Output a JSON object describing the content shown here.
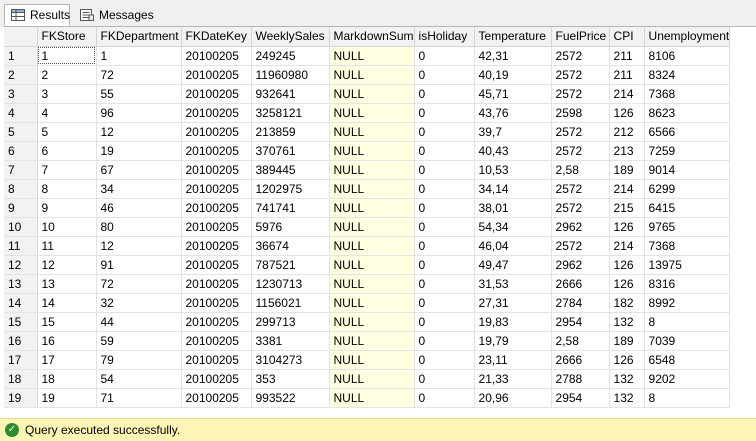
{
  "tabs": {
    "results_label": "Results",
    "messages_label": "Messages"
  },
  "grid": {
    "columns": [
      "",
      "FKStore",
      "FKDepartment",
      "FKDateKey",
      "WeeklySales",
      "MarkdownSum",
      "isHoliday",
      "Temperature",
      "FuelPrice",
      "CPI",
      "Unemployment"
    ],
    "rows": [
      [
        "1",
        "1",
        "1",
        "20100205",
        "249245",
        "NULL",
        "0",
        "42,31",
        "2572",
        "211",
        "8106"
      ],
      [
        "2",
        "2",
        "72",
        "20100205",
        "11960980",
        "NULL",
        "0",
        "40,19",
        "2572",
        "211",
        "8324"
      ],
      [
        "3",
        "3",
        "55",
        "20100205",
        "932641",
        "NULL",
        "0",
        "45,71",
        "2572",
        "214",
        "7368"
      ],
      [
        "4",
        "4",
        "96",
        "20100205",
        "3258121",
        "NULL",
        "0",
        "43,76",
        "2598",
        "126",
        "8623"
      ],
      [
        "5",
        "5",
        "12",
        "20100205",
        "213859",
        "NULL",
        "0",
        "39,7",
        "2572",
        "212",
        "6566"
      ],
      [
        "6",
        "6",
        "19",
        "20100205",
        "370761",
        "NULL",
        "0",
        "40,43",
        "2572",
        "213",
        "7259"
      ],
      [
        "7",
        "7",
        "67",
        "20100205",
        "389445",
        "NULL",
        "0",
        "10,53",
        "2,58",
        "189",
        "9014"
      ],
      [
        "8",
        "8",
        "34",
        "20100205",
        "1202975",
        "NULL",
        "0",
        "34,14",
        "2572",
        "214",
        "6299"
      ],
      [
        "9",
        "9",
        "46",
        "20100205",
        "741741",
        "NULL",
        "0",
        "38,01",
        "2572",
        "215",
        "6415"
      ],
      [
        "10",
        "10",
        "80",
        "20100205",
        "5976",
        "NULL",
        "0",
        "54,34",
        "2962",
        "126",
        "9765"
      ],
      [
        "11",
        "11",
        "12",
        "20100205",
        "36674",
        "NULL",
        "0",
        "46,04",
        "2572",
        "214",
        "7368"
      ],
      [
        "12",
        "12",
        "91",
        "20100205",
        "787521",
        "NULL",
        "0",
        "49,47",
        "2962",
        "126",
        "13975"
      ],
      [
        "13",
        "13",
        "72",
        "20100205",
        "1230713",
        "NULL",
        "0",
        "31,53",
        "2666",
        "126",
        "8316"
      ],
      [
        "14",
        "14",
        "32",
        "20100205",
        "1156021",
        "NULL",
        "0",
        "27,31",
        "2784",
        "182",
        "8992"
      ],
      [
        "15",
        "15",
        "44",
        "20100205",
        "299713",
        "NULL",
        "0",
        "19,83",
        "2954",
        "132",
        "8"
      ],
      [
        "16",
        "16",
        "59",
        "20100205",
        "3381",
        "NULL",
        "0",
        "19,79",
        "2,58",
        "189",
        "7039"
      ],
      [
        "17",
        "17",
        "79",
        "20100205",
        "3104273",
        "NULL",
        "0",
        "23,11",
        "2666",
        "126",
        "6548"
      ],
      [
        "18",
        "18",
        "54",
        "20100205",
        "353",
        "NULL",
        "0",
        "21,33",
        "2788",
        "132",
        "9202"
      ],
      [
        "19",
        "19",
        "71",
        "20100205",
        "993522",
        "NULL",
        "0",
        "20,96",
        "2954",
        "132",
        "8"
      ]
    ]
  },
  "status": {
    "message": "Query executed successfully."
  },
  "colors": {
    "null_cell_bg": "#ffffe1",
    "status_bg": "#fdf5b6",
    "ok_icon": "#2e8b2e"
  },
  "icons": {
    "results_tab": "grid-icon",
    "messages_tab": "messages-icon",
    "status": "check-circle-icon"
  }
}
